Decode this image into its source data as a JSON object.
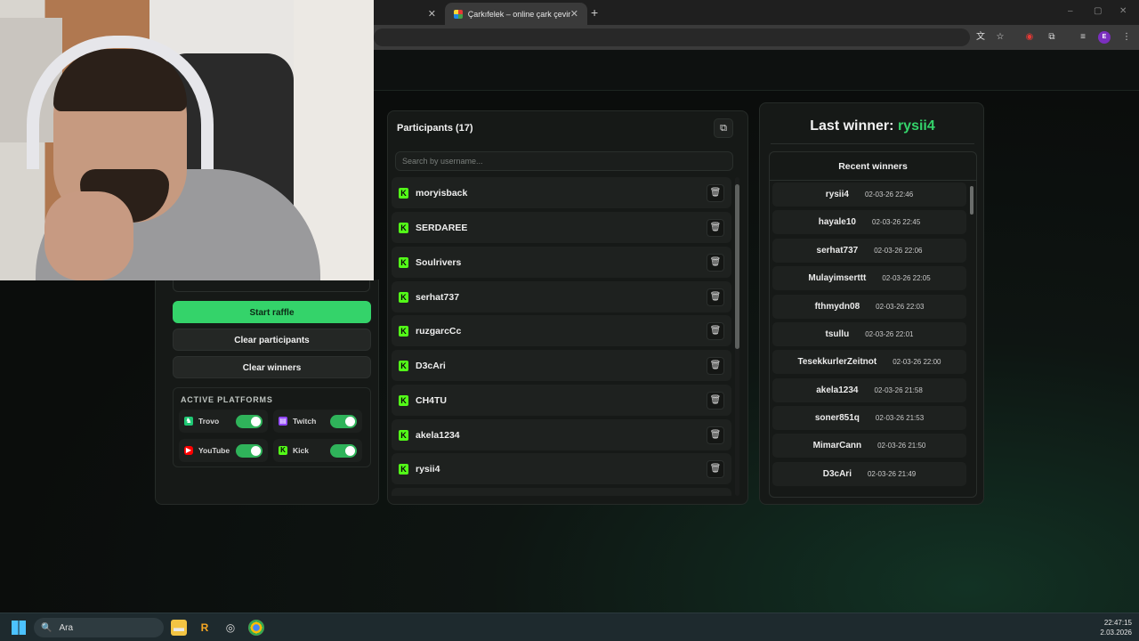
{
  "browser": {
    "tabs": [
      {
        "label": "",
        "active": false
      },
      {
        "label": "Çarkıfelek – online çark çevirme",
        "active": true
      }
    ],
    "new_tab": "+",
    "window_controls": [
      "–",
      "▢",
      "✕"
    ],
    "profile_initial": "E"
  },
  "raffle_controls": {
    "start_label": "Start raffle",
    "clear_participants_label": "Clear participants",
    "clear_winners_label": "Clear winners",
    "platforms_title": "ACTIVE PLATFORMS",
    "platforms": [
      {
        "name": "Trovo",
        "enabled": true,
        "color": "#1ec773"
      },
      {
        "name": "Twitch",
        "enabled": true,
        "color": "#9146ff"
      },
      {
        "name": "YouTube",
        "enabled": true,
        "color": "#ff0000"
      },
      {
        "name": "Kick",
        "enabled": true,
        "color": "#53fc18"
      }
    ]
  },
  "participants": {
    "title": "Participants (17)",
    "search_placeholder": "Search by username...",
    "items": [
      "moryisback",
      "SERDAREE",
      "Soulrivers",
      "serhat737",
      "ruzgarcCc",
      "D3cAri",
      "CH4TU",
      "akela1234",
      "rysii4"
    ]
  },
  "winners": {
    "last_label": "Last winner:",
    "last_name": "rysii4",
    "recent_title": "Recent winners",
    "items": [
      {
        "name": "rysii4",
        "time": "02-03-26 22:46"
      },
      {
        "name": "hayale10",
        "time": "02-03-26 22:45"
      },
      {
        "name": "serhat737",
        "time": "02-03-26 22:06"
      },
      {
        "name": "Mulayimserttt",
        "time": "02-03-26 22:05"
      },
      {
        "name": "fthmydn08",
        "time": "02-03-26 22:03"
      },
      {
        "name": "tsullu",
        "time": "02-03-26 22:01"
      },
      {
        "name": "TesekkurlerZeitnot",
        "time": "02-03-26 22:00"
      },
      {
        "name": "akela1234",
        "time": "02-03-26 21:58"
      },
      {
        "name": "soner851q",
        "time": "02-03-26 21:53"
      },
      {
        "name": "MimarCann",
        "time": "02-03-26 21:50"
      },
      {
        "name": "D3cAri",
        "time": "02-03-26 21:49"
      }
    ]
  },
  "taskbar": {
    "search_label": "Ara",
    "time": "22:47:15",
    "date": "2.03.2026"
  },
  "colors": {
    "accent": "#34d36a",
    "kick": "#53fc18",
    "panel": "#161917"
  }
}
